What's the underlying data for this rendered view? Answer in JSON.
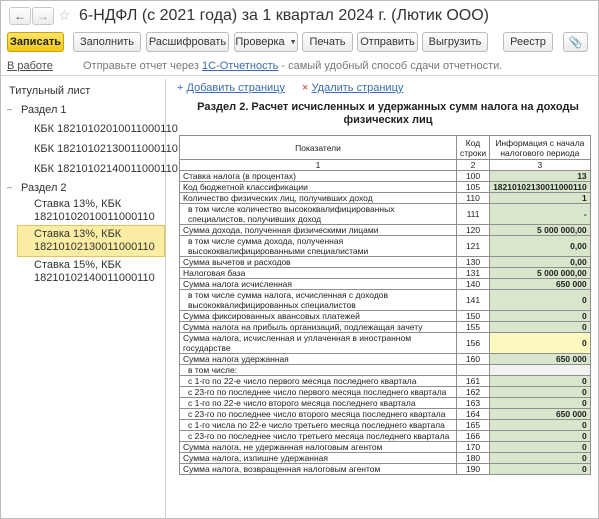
{
  "window": {
    "title": "6-НДФЛ (с 2021 года) за 1 квартал 2024 г. (Лютик ООО)",
    "back_icon": "arrow-left",
    "forward_icon": "arrow-right",
    "favorite_icon": "star"
  },
  "toolbar": {
    "buttons": [
      {
        "label": "Записать",
        "primary": true
      },
      {
        "label": "Заполнить"
      },
      {
        "label": "Расшифровать"
      },
      {
        "label": "Проверка",
        "dropdown": true
      },
      {
        "label": "Печать"
      },
      {
        "label": "Отправить"
      },
      {
        "label": "Выгрузить"
      },
      {
        "label": "Реестр"
      }
    ],
    "attach_icon": "paperclip"
  },
  "info": {
    "status": "В работе",
    "hint_before": "Отправьте отчет через ",
    "hint_link": "1С-Отчетность",
    "hint_after": " - самый удобный способ сдачи отчетности."
  },
  "sidebar": {
    "title_page": "Титульный лист",
    "section1": "Раздел 1",
    "s1_items": [
      "КБК 18210102010011000110",
      "КБК 18210102130011000110",
      "КБК 18210102140011000110"
    ],
    "section2": "Раздел 2",
    "s2_items": [
      {
        "line1": "Ставка 13%, КБК",
        "line2": "18210102010011000110"
      },
      {
        "line1": "Ставка 13%, КБК",
        "line2": "18210102130011000110",
        "selected": true
      },
      {
        "line1": "Ставка 15%, КБК",
        "line2": "18210102140011000110"
      }
    ]
  },
  "main": {
    "add_page": "Добавить страницу",
    "delete_page": "Удалить страницу",
    "doc_title_line1": "Раздел 2. Расчет исчисленных и удержанных сумм налога на доходы",
    "doc_title_line2": "физических лиц",
    "headers": {
      "col1": "Показатели",
      "col2": "Код строки",
      "col3": "Информация с начала налогового периода",
      "num1": "1",
      "num2": "2",
      "num3": "3"
    },
    "rows": [
      {
        "label": "Ставка налога (в процентах)",
        "code": "100",
        "value": "13",
        "style": "green"
      },
      {
        "label": "Код бюджетной классификации",
        "code": "105",
        "value": "18210102130011000110",
        "style": "green",
        "left": true
      },
      {
        "label": "Количество физических лиц, получивших доход",
        "code": "110",
        "value": "1",
        "style": "green"
      },
      {
        "label": "в том числе количество высококвалифицированных специалистов, получивших доход",
        "code": "111",
        "value": "-",
        "style": "green",
        "indent": true
      },
      {
        "label": "Сумма дохода, полученная физическими лицами",
        "code": "120",
        "value": "5 000 000,00",
        "style": "green"
      },
      {
        "label": "в том числе сумма дохода, полученная высококвалифицированными специалистами",
        "code": "121",
        "value": "0,00",
        "style": "green",
        "indent": true
      },
      {
        "label": "Сумма вычетов и расходов",
        "code": "130",
        "value": "0,00",
        "style": "green"
      },
      {
        "label": "Налоговая база",
        "code": "131",
        "value": "5 000 000,00",
        "style": "green"
      },
      {
        "label": "Сумма налога исчисленная",
        "code": "140",
        "value": "650 000",
        "style": "green"
      },
      {
        "label": "в том числе сумма налога, исчисленная с доходов высококвалифицированных специалистов",
        "code": "141",
        "value": "0",
        "style": "green",
        "indent": true
      },
      {
        "label": "Сумма фиксированных авансовых платежей",
        "code": "150",
        "value": "0",
        "style": "green"
      },
      {
        "label": "Сумма налога на прибыль организаций, подлежащая зачету",
        "code": "155",
        "value": "0",
        "style": "green"
      },
      {
        "label": "Сумма налога, исчисленная и уплаченная в иностранном государстве",
        "code": "156",
        "value": "0",
        "style": "yellow"
      },
      {
        "label": "Сумма налога удержанная",
        "code": "160",
        "value": "650 000",
        "style": "green"
      },
      {
        "label": "в том числе:",
        "code": "",
        "value": "",
        "style": "plain",
        "indent": true
      },
      {
        "label": "с 1-го по 22-е число первого месяца последнего квартала",
        "code": "161",
        "value": "0",
        "style": "green",
        "indent": true
      },
      {
        "label": "с 23-го по последнее число первого месяца последнего квартала",
        "code": "162",
        "value": "0",
        "style": "green",
        "indent": true
      },
      {
        "label": "с 1-го по 22-е число второго месяца последнего квартала",
        "code": "163",
        "value": "0",
        "style": "green",
        "indent": true
      },
      {
        "label": "с 23-го по последнее число второго месяца последнего квартала",
        "code": "164",
        "value": "650 000",
        "style": "green",
        "indent": true
      },
      {
        "label": "с 1-го числа по 22-е число третьего месяца последнего квартала",
        "code": "165",
        "value": "0",
        "style": "green",
        "indent": true
      },
      {
        "label": "с 23-го по последнее число третьего месяца последнего квартала",
        "code": "166",
        "value": "0",
        "style": "green",
        "indent": true
      },
      {
        "label": "Сумма налога, не удержанная налоговым агентом",
        "code": "170",
        "value": "0",
        "style": "green"
      },
      {
        "label": "Сумма налога, излишне удержанная",
        "code": "180",
        "value": "0",
        "style": "green"
      },
      {
        "label": "Сумма налога, возвращенная налоговым агентом",
        "code": "190",
        "value": "0",
        "style": "green"
      }
    ]
  }
}
